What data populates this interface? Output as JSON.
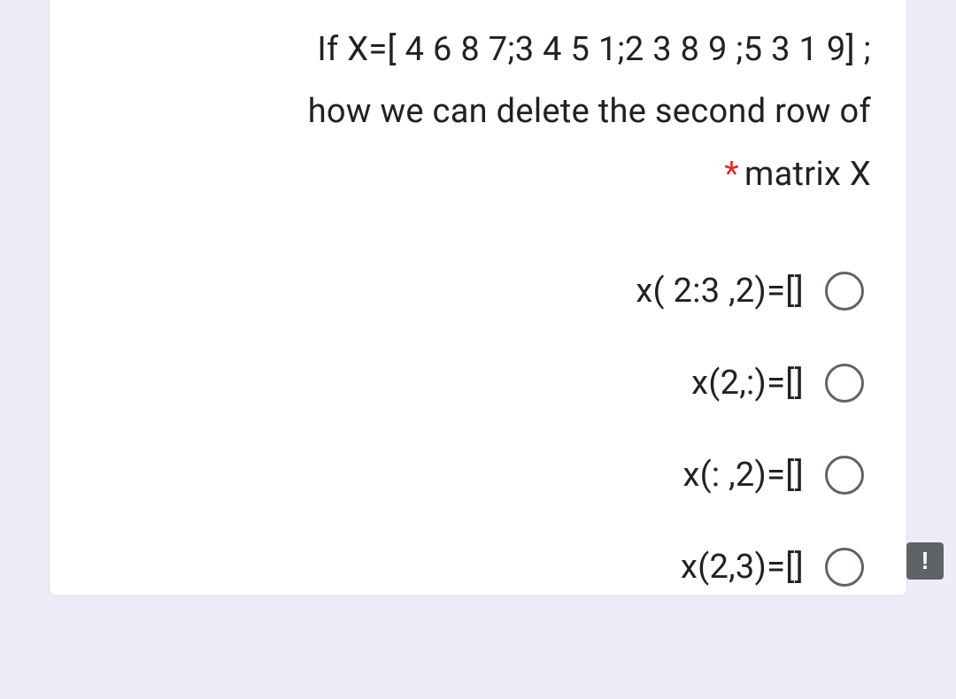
{
  "question": {
    "line1": "If X=[ 4 6 8 7;3 4 5 1;2 3 8 9 ;5 3 1 9] ;",
    "line2": "how we can delete the second row of",
    "line3": "matrix X",
    "required": true
  },
  "options": [
    {
      "label": "x( 2:3 ,2)=[]"
    },
    {
      "label": "x(2,:)=[]"
    },
    {
      "label": "x(: ,2)=[]"
    },
    {
      "label": "x(2,3)=[]"
    }
  ],
  "error_symbol": "!"
}
